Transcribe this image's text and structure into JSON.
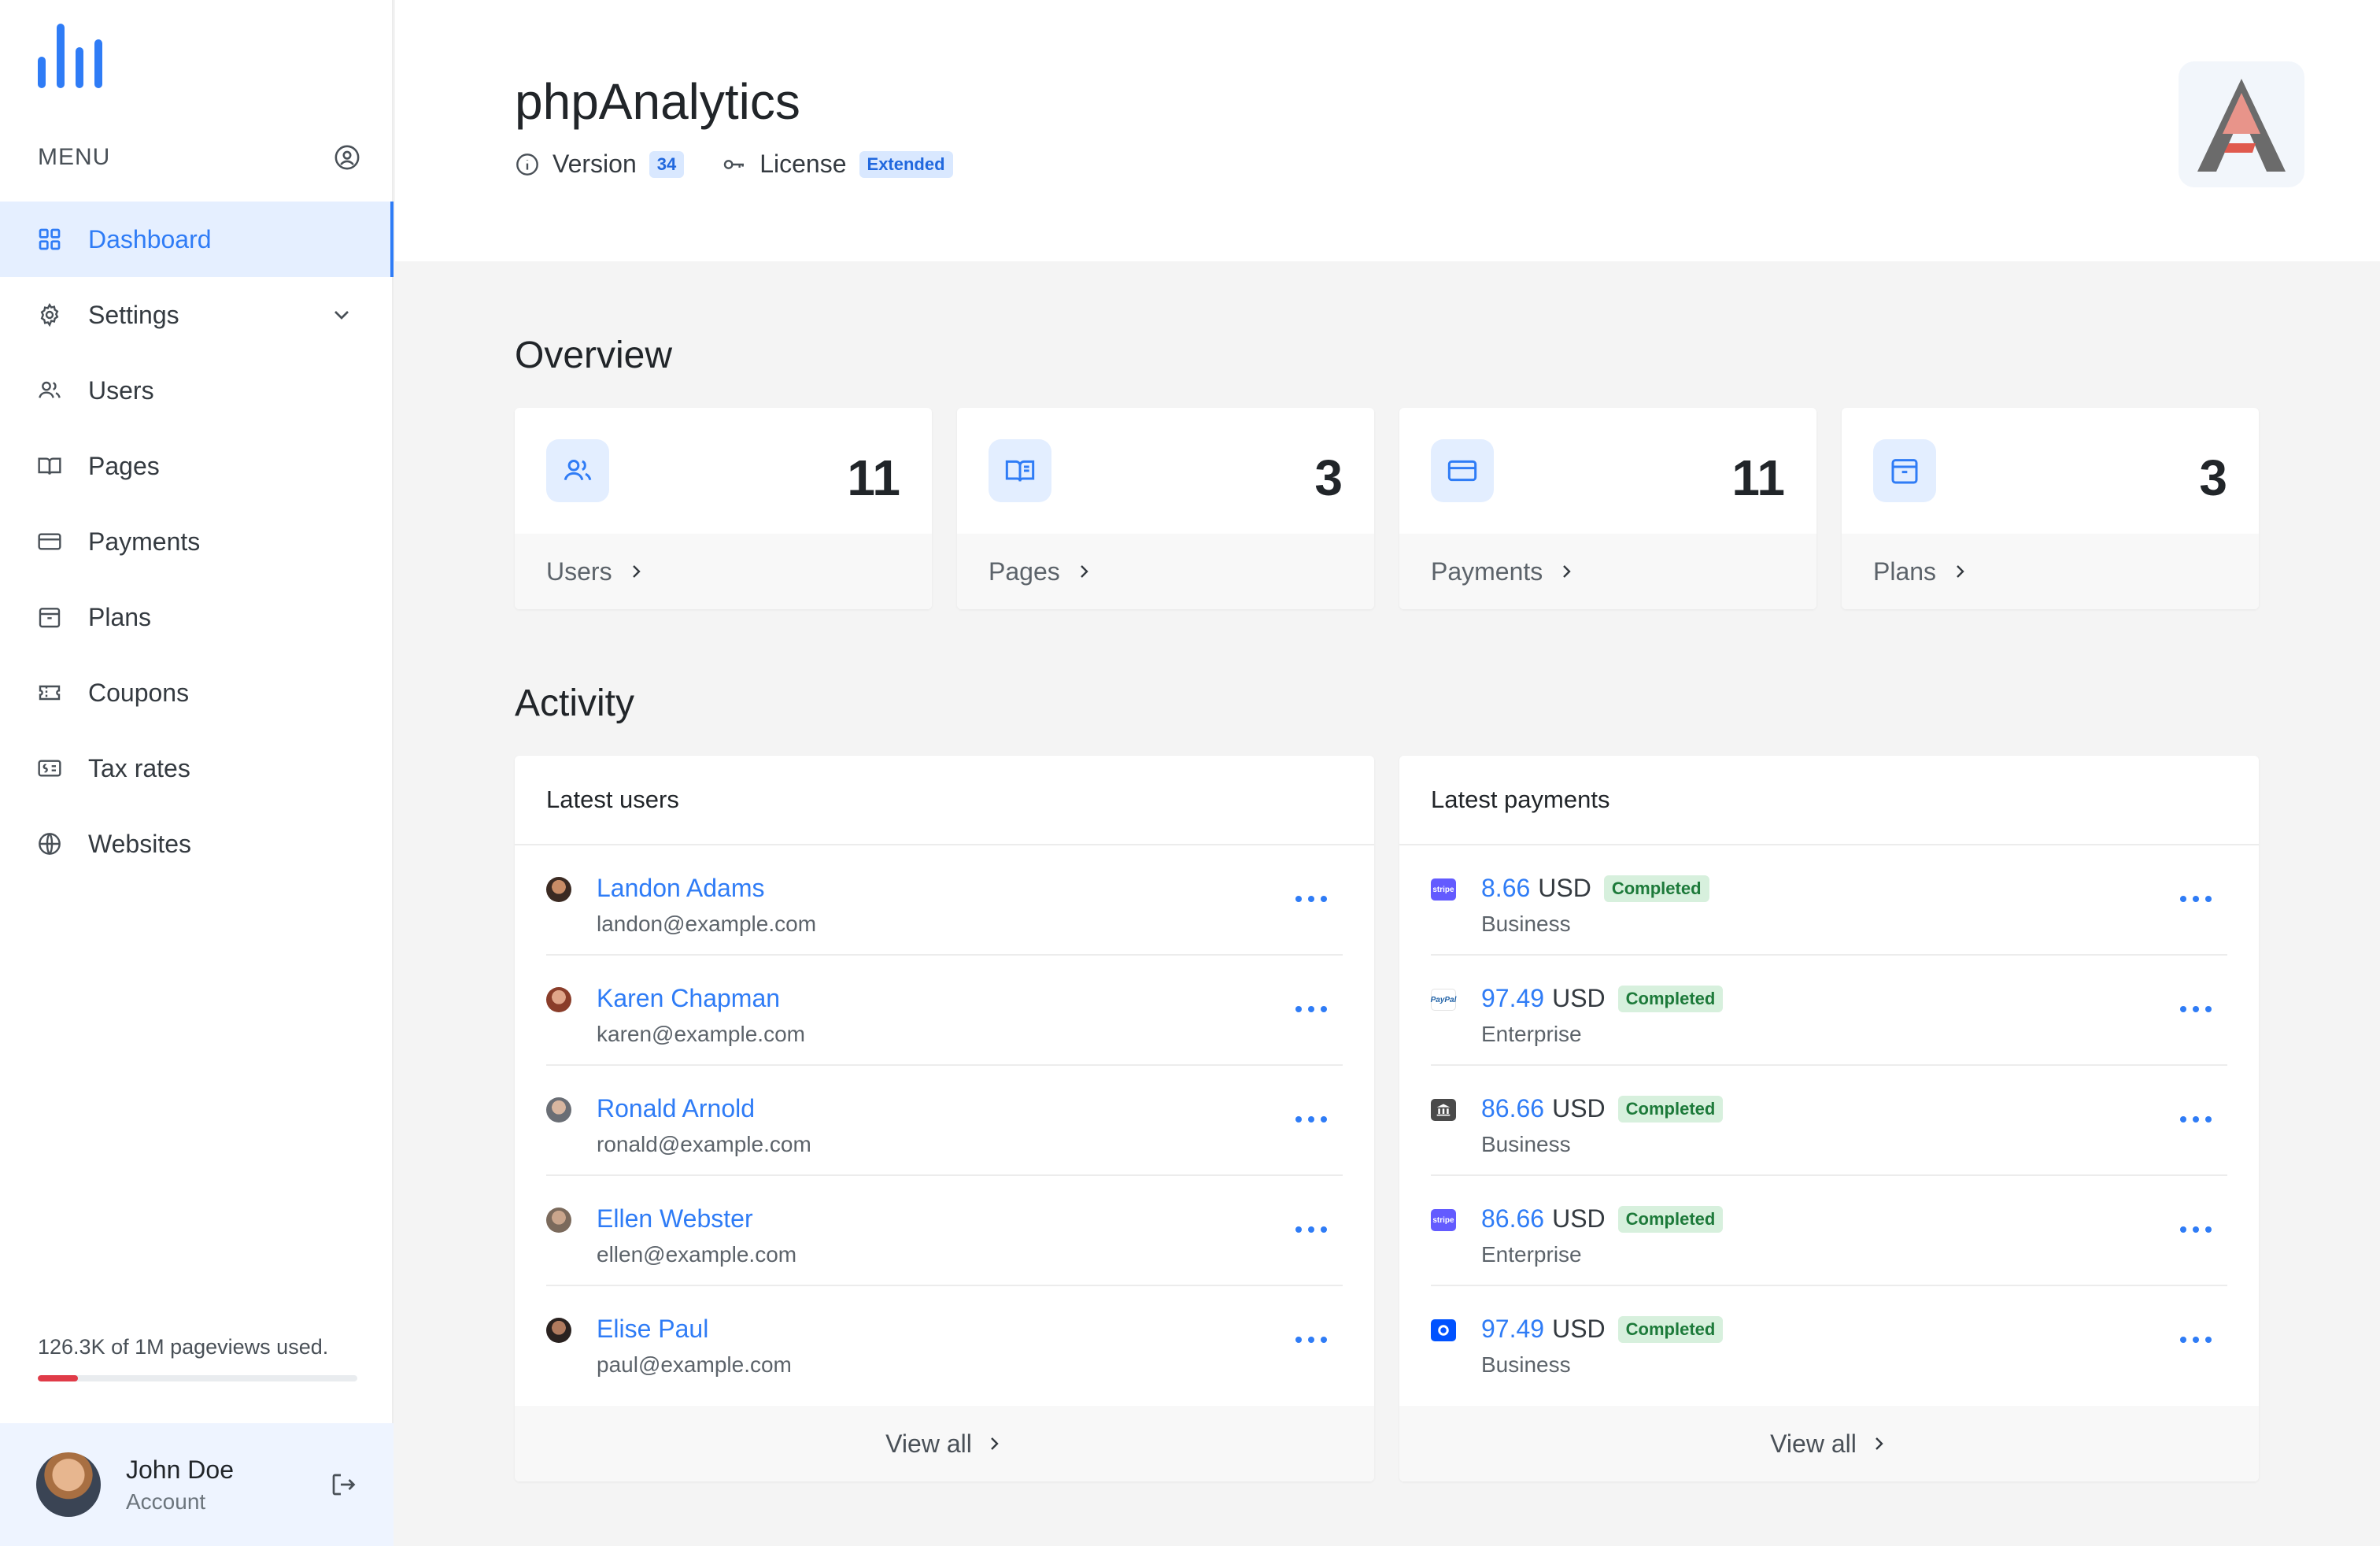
{
  "sidebar": {
    "menu_label": "MENU",
    "items": [
      {
        "label": "Dashboard",
        "icon": "dashboard-icon",
        "active": true
      },
      {
        "label": "Settings",
        "icon": "gear-icon",
        "expandable": true
      },
      {
        "label": "Users",
        "icon": "users-icon"
      },
      {
        "label": "Pages",
        "icon": "book-icon"
      },
      {
        "label": "Payments",
        "icon": "credit-card-icon"
      },
      {
        "label": "Plans",
        "icon": "package-icon"
      },
      {
        "label": "Coupons",
        "icon": "ticket-icon"
      },
      {
        "label": "Tax rates",
        "icon": "tax-icon"
      },
      {
        "label": "Websites",
        "icon": "globe-icon"
      }
    ],
    "usage": {
      "text": "126.3K of 1M pageviews used.",
      "fraction": 0.1263
    },
    "account": {
      "name": "John Doe",
      "subtitle": "Account"
    }
  },
  "header": {
    "title": "phpAnalytics",
    "version_label": "Version",
    "version_value": "34",
    "license_label": "License",
    "license_value": "Extended"
  },
  "overview": {
    "title": "Overview",
    "cards": [
      {
        "value": "11",
        "label": "Users",
        "icon": "users-icon"
      },
      {
        "value": "3",
        "label": "Pages",
        "icon": "book-icon"
      },
      {
        "value": "11",
        "label": "Payments",
        "icon": "credit-card-icon"
      },
      {
        "value": "3",
        "label": "Plans",
        "icon": "package-icon"
      }
    ]
  },
  "activity": {
    "title": "Activity",
    "latest_users": {
      "title": "Latest users",
      "rows": [
        {
          "name": "Landon Adams",
          "email": "landon@example.com"
        },
        {
          "name": "Karen Chapman",
          "email": "karen@example.com"
        },
        {
          "name": "Ronald Arnold",
          "email": "ronald@example.com"
        },
        {
          "name": "Ellen Webster",
          "email": "ellen@example.com"
        },
        {
          "name": "Elise Paul",
          "email": "paul@example.com"
        }
      ],
      "view_all": "View all"
    },
    "latest_payments": {
      "title": "Latest payments",
      "rows": [
        {
          "amount": "8.66",
          "currency": "USD",
          "status": "Completed",
          "plan": "Business",
          "processor": "stripe"
        },
        {
          "amount": "97.49",
          "currency": "USD",
          "status": "Completed",
          "plan": "Enterprise",
          "processor": "paypal"
        },
        {
          "amount": "86.66",
          "currency": "USD",
          "status": "Completed",
          "plan": "Business",
          "processor": "bank"
        },
        {
          "amount": "86.66",
          "currency": "USD",
          "status": "Completed",
          "plan": "Enterprise",
          "processor": "stripe"
        },
        {
          "amount": "97.49",
          "currency": "USD",
          "status": "Completed",
          "plan": "Business",
          "processor": "coinbase"
        }
      ],
      "view_all": "View all"
    }
  },
  "colors": {
    "accent": "#2f7cf6",
    "danger": "#e03b48",
    "success": "#1d7a3a"
  }
}
